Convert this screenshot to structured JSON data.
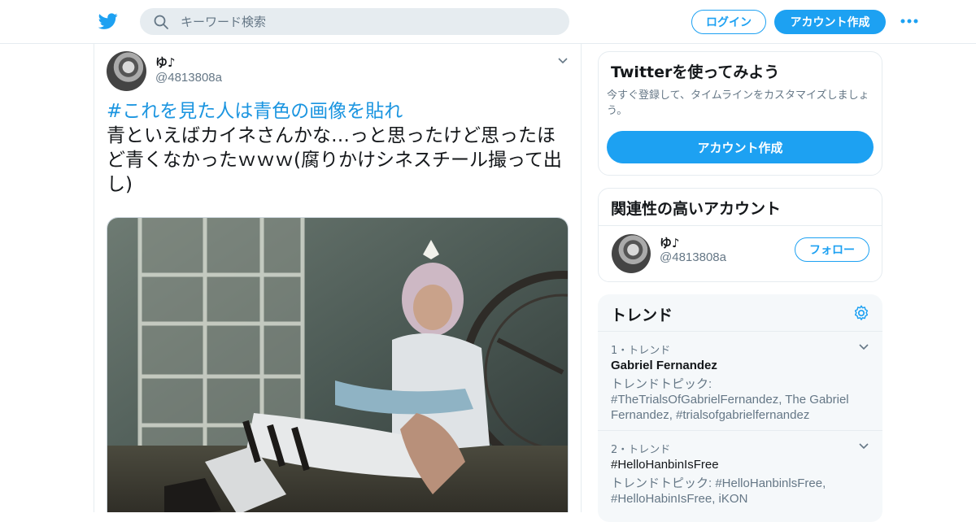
{
  "header": {
    "search_placeholder": "キーワード検索",
    "login_label": "ログイン",
    "signup_label": "アカウント作成",
    "brand_color": "#1da1f2",
    "logo_icon": "twitter-bird-icon",
    "more_icon": "more-dots-icon"
  },
  "tweet": {
    "author_name": "ゆ♪",
    "author_handle": "@4813808a",
    "hashtag": "#これを見た人は青色の画像を貼れ",
    "body": "青といえばカイネさんかな…っと思ったけど思ったほど青くなかったｗｗｗ(腐りかけシネスチール撮って出し)"
  },
  "sidebar": {
    "signup_card": {
      "title": "Twitterを使ってみよう",
      "description": "今すぐ登録して、タイムラインをカスタマイズしましょう。",
      "button_label": "アカウント作成"
    },
    "related_card": {
      "title": "関連性の高いアカウント",
      "accounts": [
        {
          "name": "ゆ♪",
          "handle": "@4813808a",
          "follow_label": "フォロー"
        }
      ]
    },
    "trends": {
      "title": "トレンド",
      "items": [
        {
          "rank": "1・トレンド",
          "name": "Gabriel Fernandez",
          "description": "トレンドトピック: #TheTrialsOfGabrielFernandez, The Gabriel Fernandez, #trialsofgabrielfernandez"
        },
        {
          "rank": "2・トレンド",
          "name": "#HelloHanbinIsFree",
          "description": "トレンドトピック: #HelloHanbinlsFree, #HelloHabinIsFree, iKON"
        }
      ]
    }
  }
}
